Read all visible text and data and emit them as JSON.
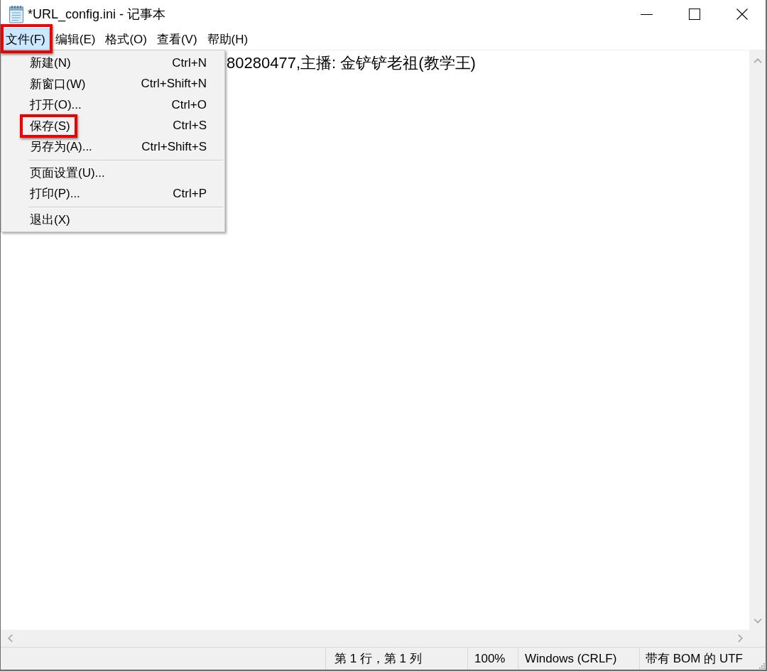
{
  "window": {
    "title": "*URL_config.ini - 记事本"
  },
  "menu_bar": [
    {
      "label": "文件(F)",
      "selected": true,
      "highlighted": true
    },
    {
      "label": "编辑(E)",
      "selected": false,
      "highlighted": false
    },
    {
      "label": "格式(O)",
      "selected": false,
      "highlighted": false
    },
    {
      "label": "查看(V)",
      "selected": false,
      "highlighted": false
    },
    {
      "label": "帮助(H)",
      "selected": false,
      "highlighted": false
    }
  ],
  "file_menu": [
    {
      "kind": "item",
      "label": "新建(N)",
      "shortcut": "Ctrl+N",
      "highlighted": false
    },
    {
      "kind": "item",
      "label": "新窗口(W)",
      "shortcut": "Ctrl+Shift+N",
      "highlighted": false
    },
    {
      "kind": "item",
      "label": "打开(O)...",
      "shortcut": "Ctrl+O",
      "highlighted": false
    },
    {
      "kind": "item",
      "label": "保存(S)",
      "shortcut": "Ctrl+S",
      "highlighted": true
    },
    {
      "kind": "item",
      "label": "另存为(A)...",
      "shortcut": "Ctrl+Shift+S",
      "highlighted": false
    },
    {
      "kind": "separator"
    },
    {
      "kind": "item",
      "label": "页面设置(U)...",
      "highlighted": false
    },
    {
      "kind": "item",
      "label": "打印(P)...",
      "shortcut": "Ctrl+P",
      "highlighted": false
    },
    {
      "kind": "separator"
    },
    {
      "kind": "item",
      "label": "退出(X)",
      "highlighted": false
    }
  ],
  "editor": {
    "text": "80280477,主播: 金铲铲老祖(教学王)"
  },
  "status_bar": [
    "第 1 行，第 1 列",
    "100%",
    "Windows (CRLF)",
    "带有 BOM 的 UTF"
  ]
}
